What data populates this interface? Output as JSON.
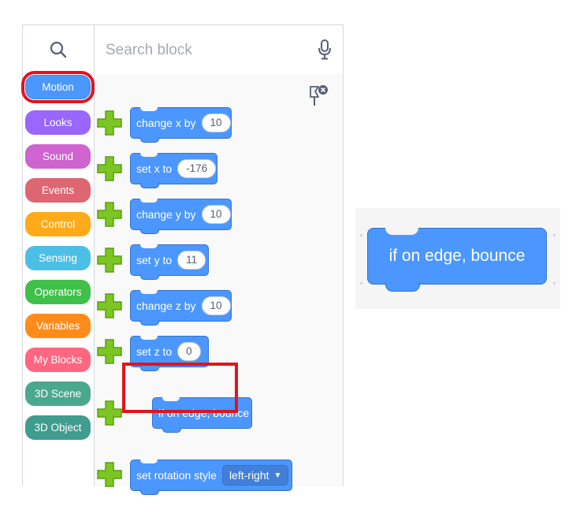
{
  "search": {
    "placeholder": "Search block"
  },
  "categories": [
    {
      "label": "Motion",
      "color": "#4c97ff",
      "selected": true
    },
    {
      "label": "Looks",
      "color": "#9966ff"
    },
    {
      "label": "Sound",
      "color": "#cf63cf"
    },
    {
      "label": "Events",
      "color": "#de6671"
    },
    {
      "label": "Control",
      "color": "#ffab19"
    },
    {
      "label": "Sensing",
      "color": "#4cbfe6"
    },
    {
      "label": "Operators",
      "color": "#40bf4a"
    },
    {
      "label": "Variables",
      "color": "#ff8c1a"
    },
    {
      "label": "My Blocks",
      "color": "#ff6680"
    },
    {
      "label": "3D Scene",
      "color": "#4aa88f"
    },
    {
      "label": "3D Object",
      "color": "#3f9c8e"
    }
  ],
  "blocks": [
    {
      "label": "change x by",
      "value": "10"
    },
    {
      "label": "set x to",
      "value": "-176"
    },
    {
      "label": "change y by",
      "value": "10"
    },
    {
      "label": "set y to",
      "value": "11"
    },
    {
      "label": "change z by",
      "value": "10"
    },
    {
      "label": "set z to",
      "value": "0"
    },
    {
      "label": "if on edge, bounce",
      "highlighted": true
    },
    {
      "label": "set rotation style",
      "dropdown": "left-right"
    }
  ],
  "preview": {
    "label": "if on edge, bounce"
  },
  "icons": {
    "search": "search-icon",
    "mic": "microphone-icon",
    "pin": "pin-clear-icon",
    "add": "green-plus-icon"
  },
  "colors": {
    "motion": "#4c97ff",
    "highlight": "#e0141c",
    "add": "#7cc623"
  }
}
